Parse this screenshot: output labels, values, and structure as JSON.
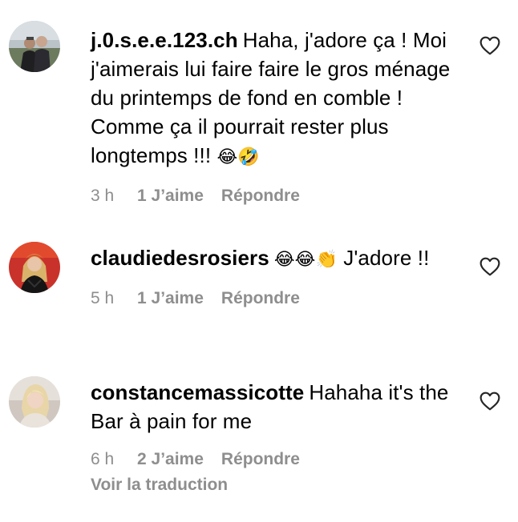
{
  "comments": [
    {
      "username": "j.0.s.e.e.123.ch",
      "text": "Haha, j'adore ça ! Moi j'aimerais lui faire faire le gros ménage du printemps de fond en comble ! Comme ça il pourrait rester plus longtemps !!!",
      "emoji": "😂🤣",
      "time": "3 h",
      "likes": "1 J’aime",
      "reply": "Répondre",
      "avatar": "avatar-two-people-icon"
    },
    {
      "username": "claudiedesrosiers",
      "text_prefix_emoji": "😂😂👏",
      "text": "J'adore !!",
      "time": "5 h",
      "likes": "1 J’aime",
      "reply": "Répondre",
      "avatar": "avatar-woman-red-background-icon"
    },
    {
      "username": "constancemassicotte",
      "text": "Hahaha it's the Bar à pain for me",
      "time": "6 h",
      "likes": "2 J’aime",
      "reply": "Répondre",
      "translate": "Voir la traduction",
      "avatar": "avatar-blonde-woman-icon"
    }
  ],
  "colors": {
    "text": "#000000",
    "meta": "#8e8e8e",
    "background": "#ffffff"
  }
}
